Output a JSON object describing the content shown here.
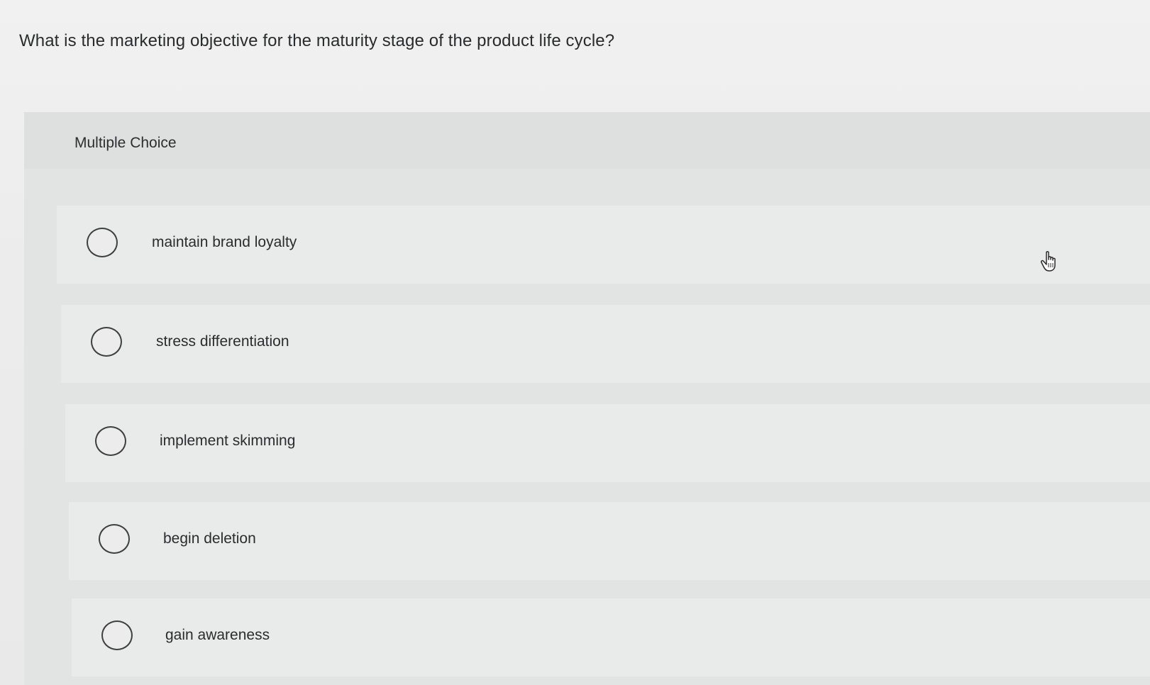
{
  "question": {
    "text": "What is the marketing objective for the maturity stage of the product life cycle?"
  },
  "panel": {
    "label": "Multiple Choice"
  },
  "options": [
    {
      "label": "maintain brand loyalty",
      "selected": false
    },
    {
      "label": "stress differentiation",
      "selected": false
    },
    {
      "label": "implement skimming",
      "selected": false
    },
    {
      "label": "begin deletion",
      "selected": false
    },
    {
      "label": "gain awareness",
      "selected": false
    }
  ],
  "cursor": {
    "icon": "hand-pointer-icon"
  }
}
